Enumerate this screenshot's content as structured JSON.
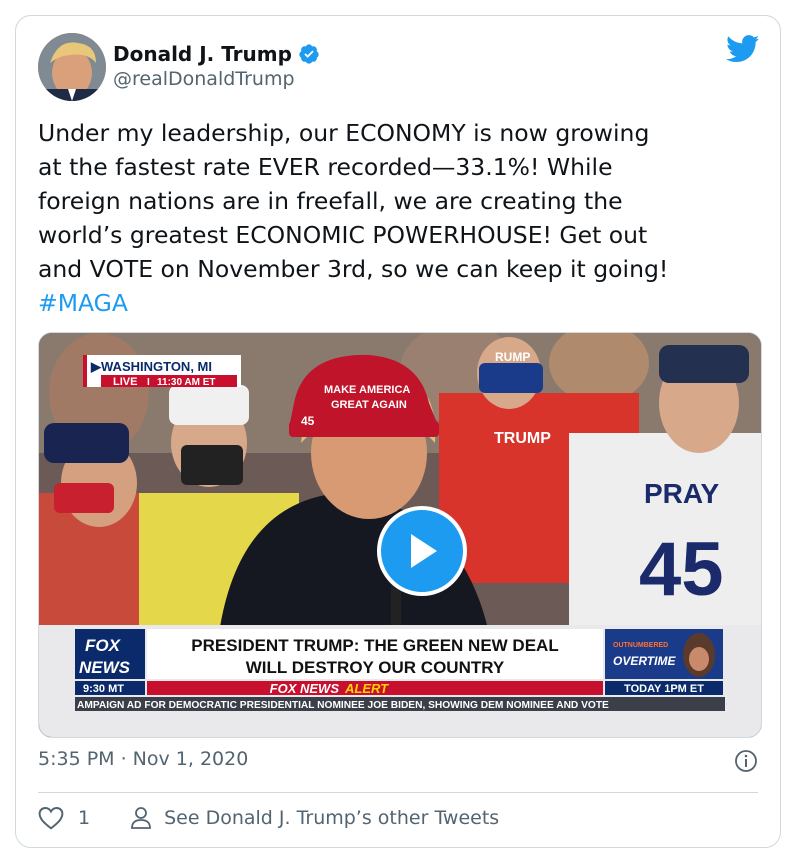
{
  "author": {
    "name": "Donald J. Trump",
    "handle": "@realDonaldTrump"
  },
  "tweet": {
    "text": "Under my leadership, our ECONOMY is now growing\nat the fastest rate EVER recorded—33.1%! While\nforeign nations are in freefall, we are creating the\nworld’s greatest ECONOMIC POWERHOUSE! Get out\nand VOTE on November 3rd, so we can keep it going!",
    "hashtag": "#MAGA",
    "timestamp": "5:35 PM · Nov 1, 2020"
  },
  "video": {
    "location": "WASHINGTON, MI",
    "live_label": "LIVE",
    "live_time": "11:30 AM ET",
    "headline_line1": "PRESIDENT TRUMP: THE GREEN NEW DEAL",
    "headline_line2": "WILL DESTROY OUR COUNTRY",
    "alert_brand": "FOX NEWS",
    "alert_word": "ALERT",
    "fox_logo_top": "FOX",
    "fox_logo_bottom": "NEWS",
    "clock": "9:30 MT",
    "promo_top": "OUTNUMBERED",
    "promo_mid": "OVERTIME",
    "promo_time": "TODAY 1PM ET",
    "ticker": "AMPAIGN AD FOR DEMOCRATIC PRESIDENTIAL NOMINEE JOE BIDEN, SHOWING DEM NOMINEE AND VOTE",
    "hat_text_1": "MAKE AMERICA",
    "hat_text_2": "GREAT AGAIN",
    "hat_number": "45",
    "sign_trump": "TRUMP",
    "shirt_pray": "PRAY",
    "shirt_number": "45"
  },
  "actions": {
    "like_count": "1",
    "other_tweets_label": "See Donald J. Trump’s other Tweets"
  },
  "colors": {
    "accent": "#1d9bf0",
    "fox_red": "#c8102e",
    "fox_blue": "#0a2a6b"
  }
}
